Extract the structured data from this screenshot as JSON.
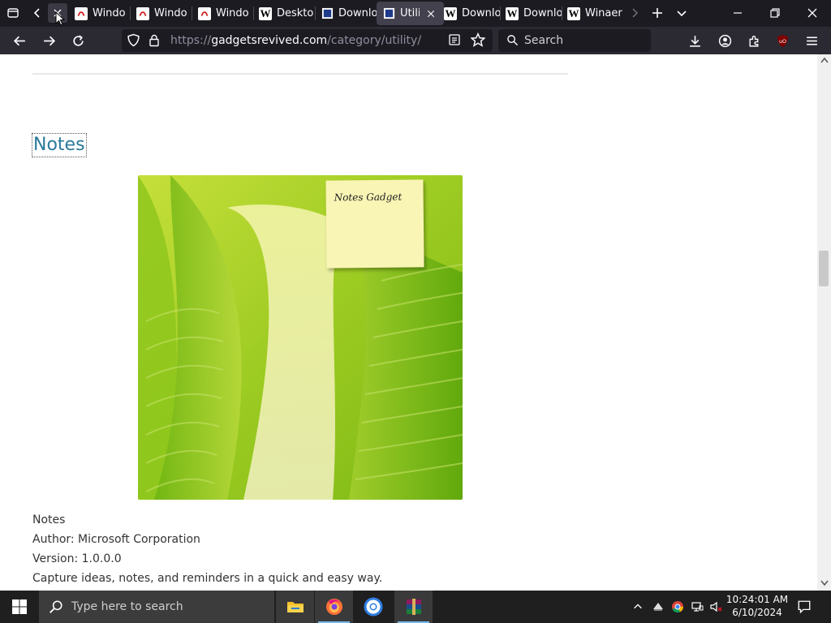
{
  "browser": {
    "tabs": [
      {
        "label": "Windo",
        "favicon": "pdf-icon"
      },
      {
        "label": "Windo",
        "favicon": "pdf-icon"
      },
      {
        "label": "Windo",
        "favicon": "pdf-icon"
      },
      {
        "label": "Deskto",
        "favicon": "wiki-w-icon"
      },
      {
        "label": "Downlo",
        "favicon": "blue-site-icon"
      },
      {
        "label": "Utili",
        "favicon": "blue-site-icon",
        "active": true
      },
      {
        "label": "Downlo",
        "favicon": "wiki-w-icon"
      },
      {
        "label": "Downlo",
        "favicon": "wiki-w-icon"
      },
      {
        "label": "Winaer",
        "favicon": "wiki-w-icon"
      }
    ],
    "favicon_letter": "W",
    "url_prefix": "https://",
    "url_host": "gadgetsrevived.com",
    "url_path": "/category/utility/",
    "search_placeholder": "Search",
    "accent_color": "#00ddff"
  },
  "page": {
    "heading": "Notes",
    "sticky_note_text": "Notes Gadget",
    "info": {
      "name": "Notes",
      "author": "Author: Microsoft Corporation",
      "version": "Version: 1.0.0.0",
      "description": "Capture ideas, notes, and reminders in a quick and easy way."
    },
    "link_color": "#2a7a9c"
  },
  "taskbar": {
    "search_placeholder": "Type here to search",
    "apps": [
      "file-explorer-icon",
      "firefox-icon",
      "chrome-icon",
      "winrar-icon"
    ],
    "clock": {
      "time": "10:24:01 AM",
      "date": "6/10/2024"
    }
  }
}
